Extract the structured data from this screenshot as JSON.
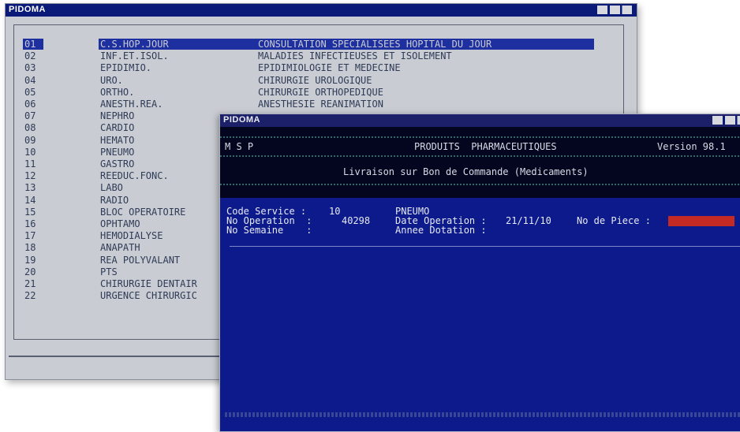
{
  "back_window": {
    "title": "PIDOMA",
    "items": [
      {
        "num": "01",
        "abbr": "C.S.HOP.JOUR",
        "desc": "CONSULTATION SPECIALISEES HOPITAL DU JOUR",
        "selected": true
      },
      {
        "num": "02",
        "abbr": "INF.ET.ISOL.",
        "desc": "MALADIES INFECTIEUSES ET ISOLEMENT"
      },
      {
        "num": "03",
        "abbr": "EPIDIMIO.",
        "desc": "EPIDIMIOLOGIE ET MEDECINE"
      },
      {
        "num": "04",
        "abbr": "URO.",
        "desc": "CHIRURGIE UROLOGIQUE"
      },
      {
        "num": "05",
        "abbr": "ORTHO.",
        "desc": "CHIRURGIE ORTHOPEDIQUE"
      },
      {
        "num": "06",
        "abbr": "ANESTH.REA.",
        "desc": "ANESTHESIE REANIMATION"
      },
      {
        "num": "07",
        "abbr": "NEPHRO",
        "desc": ""
      },
      {
        "num": "08",
        "abbr": "CARDIO",
        "desc": ""
      },
      {
        "num": "09",
        "abbr": "HEMATO",
        "desc": ""
      },
      {
        "num": "10",
        "abbr": "PNEUMO",
        "desc": ""
      },
      {
        "num": "11",
        "abbr": "GASTRO",
        "desc": ""
      },
      {
        "num": "12",
        "abbr": "REEDUC.FONC.",
        "desc": ""
      },
      {
        "num": "13",
        "abbr": "LABO",
        "desc": ""
      },
      {
        "num": "14",
        "abbr": "RADIO",
        "desc": ""
      },
      {
        "num": "15",
        "abbr": "BLOC OPERATOIRE",
        "desc": ""
      },
      {
        "num": "16",
        "abbr": "OPHTAMO",
        "desc": ""
      },
      {
        "num": "17",
        "abbr": "HEMODIALYSE",
        "desc": ""
      },
      {
        "num": "18",
        "abbr": "ANAPATH",
        "desc": ""
      },
      {
        "num": "19",
        "abbr": "REA POLYVALANT",
        "desc": ""
      },
      {
        "num": "20",
        "abbr": "PTS",
        "desc": ""
      },
      {
        "num": "21",
        "abbr": "CHIRURGIE DENTAIR",
        "desc": ""
      },
      {
        "num": "22",
        "abbr": "URGENCE CHIRURGIC",
        "desc": ""
      }
    ]
  },
  "front_window": {
    "title": "PIDOMA",
    "header": {
      "left": "M S P",
      "center": "PRODUITS  PHARMACEUTIQUES",
      "version": "Version 98.1",
      "subtitle": "Livraison sur Bon de Commande (Medicaments)"
    },
    "form": {
      "code_service_label": "Code Service :",
      "code_service_value": "10",
      "code_service_name": "PNEUMO",
      "no_operation_label": "No Operation  :",
      "no_operation_value": "40298",
      "date_operation_label": "Date Operation :",
      "date_operation_value": "21/11/10",
      "no_piece_label": "No de Piece :",
      "no_piece_value": "",
      "no_semaine_label": "No Semaine    :",
      "annee_dotation_label": "Annee Dotation :"
    }
  },
  "colors": {
    "back_bg": "#c9ccd2",
    "title_blue": "#0a1a78",
    "front_bg": "#0c1a8c",
    "field_red": "#c42a24"
  }
}
